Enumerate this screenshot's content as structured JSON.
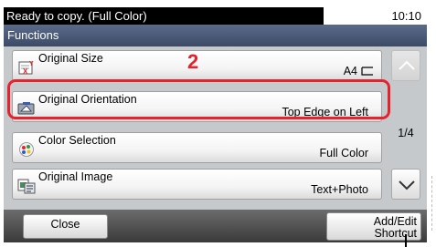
{
  "status": {
    "message": "Ready to copy. (Full Color)",
    "time": "10:10"
  },
  "header": {
    "title": "Functions"
  },
  "step_number": "2",
  "functions": [
    {
      "label": "Original Size",
      "value": "A4",
      "icon": "original-size-icon"
    },
    {
      "label": "Original Orientation",
      "value": "Top Edge on Left",
      "icon": "original-orientation-icon"
    },
    {
      "label": "Color Selection",
      "value": "Full Color",
      "icon": "color-selection-icon"
    },
    {
      "label": "Original Image",
      "value": "Text+Photo",
      "icon": "original-image-icon"
    }
  ],
  "pager": {
    "indicator": "1/4"
  },
  "footer": {
    "close_label": "Close",
    "shortcut_line1": "Add/Edit",
    "shortcut_line2": "Shortcut"
  },
  "colors": {
    "highlight": "#e8222c",
    "status_bar": "#000000",
    "header": "#3c4a66"
  }
}
